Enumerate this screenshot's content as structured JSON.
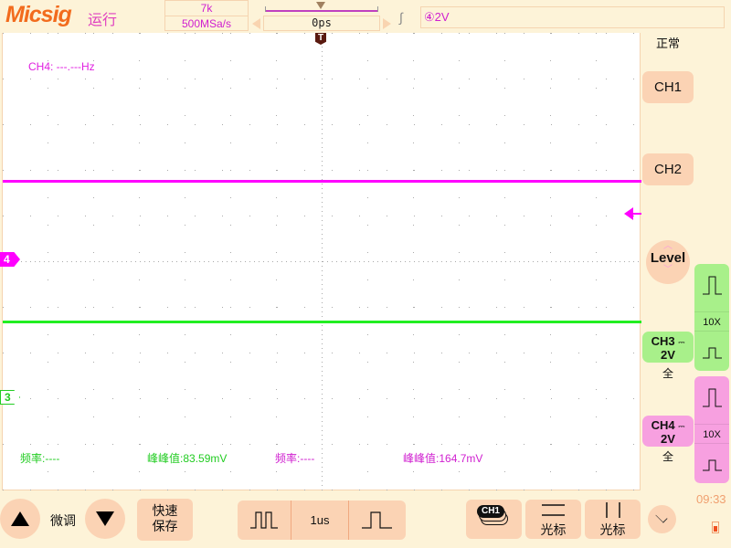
{
  "header": {
    "logo": "Micsig",
    "run_state": "运行",
    "memory_depth": "7k",
    "sample_rate": "500MSa/s",
    "horizontal_delay": "0ps",
    "trigger_slope_icon": "rising-edge-icon",
    "trigger_info": "④2V",
    "acquire_mode": "正常"
  },
  "plot": {
    "freq_readout": "CH4: ---.---Hz",
    "trigger_marker": "T",
    "ch4_marker": "4",
    "ch3_marker": "3",
    "measurements": [
      {
        "label": "频率:",
        "value": "----",
        "color": "#22cc22"
      },
      {
        "label": "峰峰值:",
        "value": "83.59mV",
        "color": "#22cc22"
      },
      {
        "label": "频率:",
        "value": "----",
        "color": "#d020d0"
      },
      {
        "label": "峰峰值:",
        "value": "164.7mV",
        "color": "#d020d0"
      }
    ],
    "traces": {
      "ch4_color": "#ff00ff",
      "ch3_color": "#22ee22"
    }
  },
  "side": {
    "ch1": "CH1",
    "ch2": "CH2",
    "level": "Level",
    "ch3": {
      "name": "CH3",
      "scale": "2V",
      "coupling_icon": "dc-icon",
      "bandwidth": "全",
      "probe": "10X",
      "color": "#a8f08a"
    },
    "ch4": {
      "name": "CH4",
      "scale": "2V",
      "coupling_icon": "dc-icon",
      "bandwidth": "全",
      "probe": "10X",
      "color": "#f7a0e0"
    }
  },
  "bottom": {
    "fine_adjust": "微调",
    "quick_save_1": "快速",
    "quick_save_2": "保存",
    "timebase": "1us",
    "ch_select": "CH1",
    "cursor_h": "光标",
    "cursor_v": "光标",
    "time": "09:33"
  }
}
